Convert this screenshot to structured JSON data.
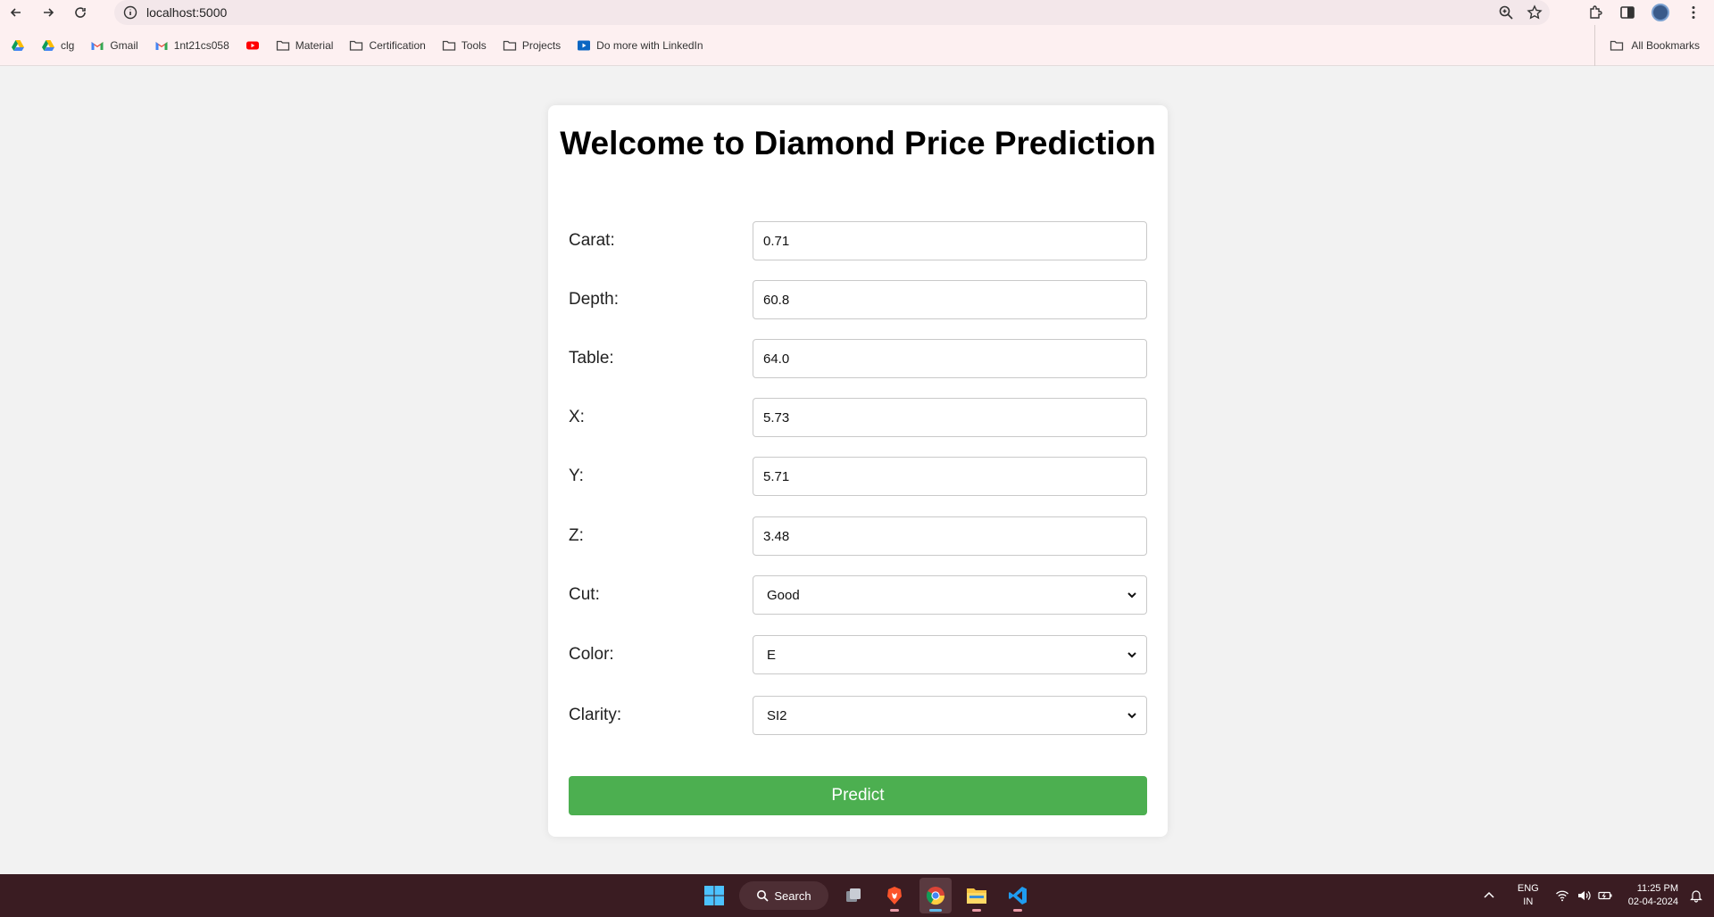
{
  "browser": {
    "url": "localhost:5000",
    "bookmarks": [
      {
        "label": "",
        "icon": "google-drive-icon"
      },
      {
        "label": "clg",
        "icon": "google-drive-icon"
      },
      {
        "label": "Gmail",
        "icon": "gmail-icon"
      },
      {
        "label": "1nt21cs058",
        "icon": "gmail-icon"
      },
      {
        "label": "",
        "icon": "youtube-icon"
      },
      {
        "label": "Material",
        "icon": "folder-icon"
      },
      {
        "label": "Certification",
        "icon": "folder-icon"
      },
      {
        "label": "Tools",
        "icon": "folder-icon"
      },
      {
        "label": "Projects",
        "icon": "folder-icon"
      },
      {
        "label": "Do more with LinkedIn",
        "icon": "linkedin-learning-icon"
      }
    ],
    "all_bookmarks": "All Bookmarks"
  },
  "form": {
    "title": "Welcome to Diamond Price Prediction",
    "fields": [
      {
        "label": "Carat:",
        "value": "0.71"
      },
      {
        "label": "Depth:",
        "value": "60.8"
      },
      {
        "label": "Table:",
        "value": "64.0"
      },
      {
        "label": "X:",
        "value": "5.73"
      },
      {
        "label": "Y:",
        "value": "5.71"
      },
      {
        "label": "Z:",
        "value": "3.48"
      }
    ],
    "selects": [
      {
        "label": "Cut:",
        "value": "Good"
      },
      {
        "label": "Color:",
        "value": "E"
      },
      {
        "label": "Clarity:",
        "value": "SI2"
      }
    ],
    "submit_label": "Predict",
    "accent": "#4caf50"
  },
  "taskbar": {
    "search_label": "Search",
    "lang_top": "ENG",
    "lang_bottom": "IN",
    "time": "11:25 PM",
    "date": "02-04-2024"
  }
}
